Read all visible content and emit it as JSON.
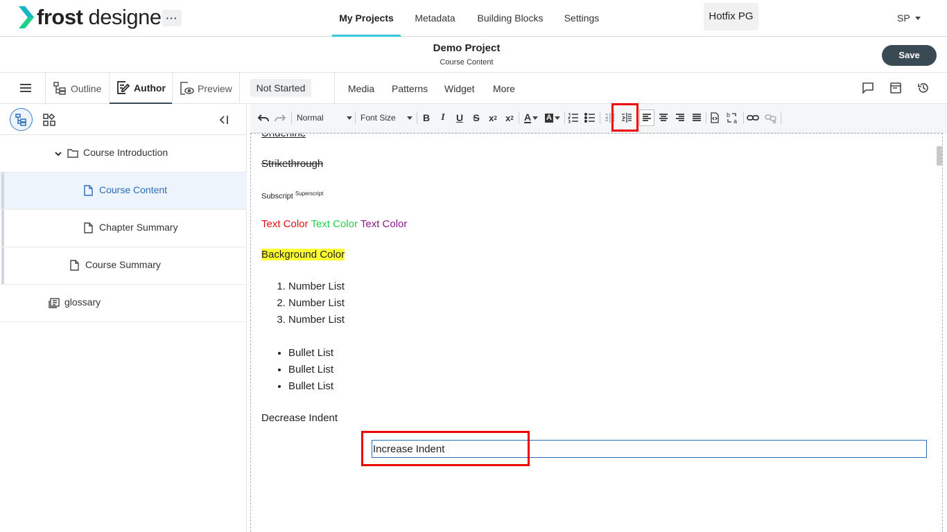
{
  "app": {
    "logo_bold": "frost",
    "logo_light": "designer",
    "more_label": "···",
    "nav": [
      "My Projects",
      "Metadata",
      "Building Blocks",
      "Settings"
    ],
    "tenant": "Hotfix PG",
    "user": "SP"
  },
  "project": {
    "title": "Demo Project",
    "subtitle": "Course Content",
    "save_label": "Save"
  },
  "modes": {
    "outline": "Outline",
    "author": "Author",
    "preview": "Preview",
    "status": "Not Started",
    "tabs": [
      "Media",
      "Patterns",
      "Widget",
      "More"
    ],
    "right_icons": [
      "comment-icon",
      "panel-icon",
      "history-icon"
    ]
  },
  "tree": [
    {
      "label": "Course Introduction",
      "icon": "folder-icon",
      "expanded": true
    },
    {
      "label": "Course Content",
      "icon": "file-icon",
      "active": true
    },
    {
      "label": "Chapter Summary",
      "icon": "file-icon"
    },
    {
      "label": "Course Summary",
      "icon": "file-icon"
    },
    {
      "label": "glossary",
      "icon": "glossary-icon"
    }
  ],
  "toolbar": {
    "format": "Normal",
    "font_size": "Font Size"
  },
  "content": {
    "underline_partial": "Underline",
    "strike": "Strikethrough",
    "subscript": "Subscript",
    "superscript": "Superscript",
    "color_text_1": "Text Color",
    "color_text_2": "Text Color",
    "color_text_3": "Text Color",
    "bg_text": "Background Color",
    "numbered": [
      "Number List",
      "Number List",
      "Number List"
    ],
    "bullets": [
      "Bullet List",
      "Bullet List",
      "Bullet List"
    ],
    "decrease": "Decrease Indent",
    "increase": "Increase Indent"
  },
  "colors": {
    "accent": "#35c7d6",
    "save_bg": "#3a4a54",
    "text_red": "#e01010",
    "text_green": "#1ed04a",
    "text_purple": "#8b1a8b",
    "highlight": "#ffff33",
    "annotation_red": "#ee0000"
  }
}
